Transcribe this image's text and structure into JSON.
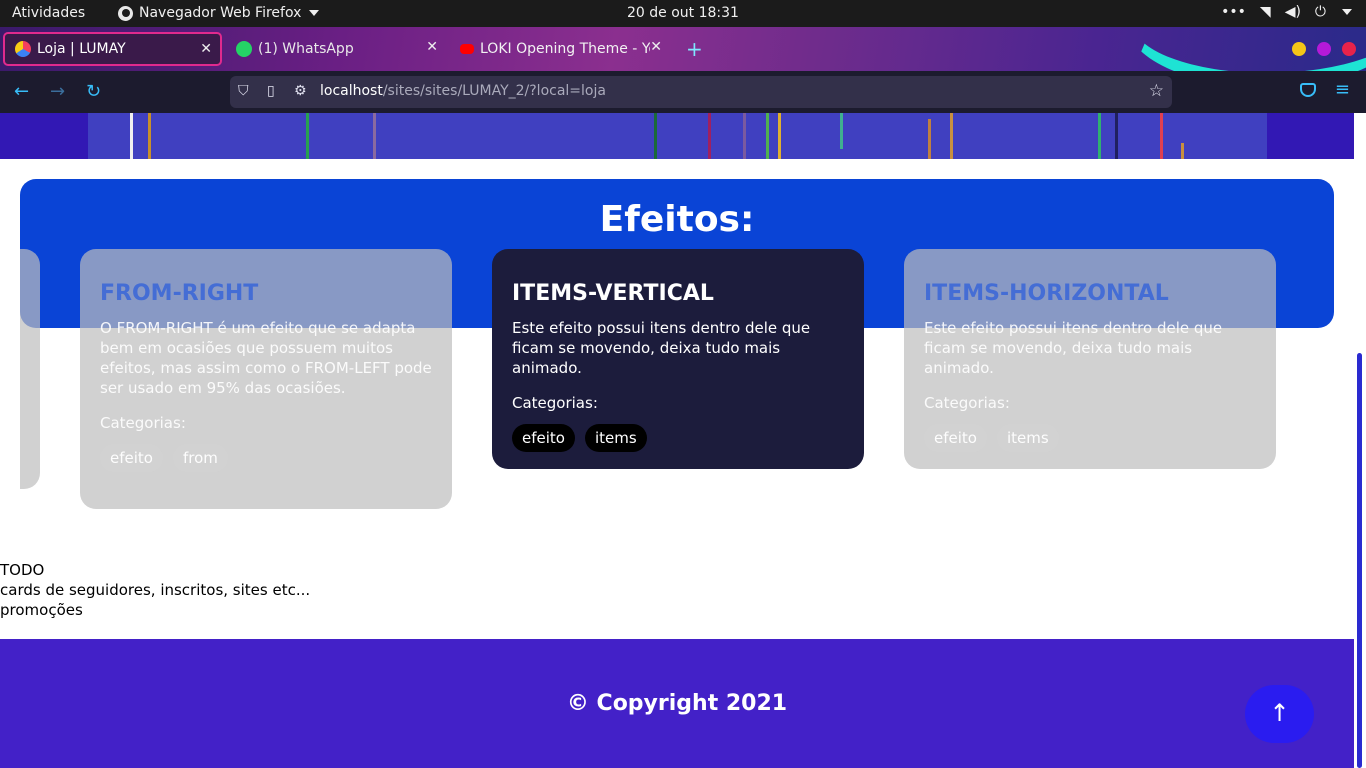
{
  "system_bar": {
    "activities": "Atividades",
    "app_name": "Navegador Web Firefox",
    "clock": "20 de out  18:31"
  },
  "tabs": [
    {
      "title": "Loja | LUMAY",
      "active": true
    },
    {
      "title": "(1) WhatsApp",
      "active": false
    },
    {
      "title": "LOKI Opening Theme - Yo",
      "active": false
    }
  ],
  "address_bar": {
    "host": "localhost",
    "path": "/sites/sites/LUMAY_2/?local=loja"
  },
  "section": {
    "title": "Efeitos:"
  },
  "cards": [
    {
      "title": "FROM-RIGHT",
      "description": "O FROM-RIGHT é um efeito que se adapta bem em ocasiões que possuem muitos efeitos, mas assim como o FROM-LEFT pode ser usado em 95% das ocasiões.",
      "categories_label": "Categorias:",
      "tags": [
        "efeito",
        "from"
      ]
    },
    {
      "title": "ITEMS-VERTICAL",
      "description": "Este efeito possui itens dentro dele que ficam se movendo, deixa tudo mais animado.",
      "categories_label": "Categorias:",
      "tags": [
        "efeito",
        "items"
      ]
    },
    {
      "title": "ITEMS-HORIZONTAL",
      "description": "Este efeito possui itens dentro dele que ficam se movendo, deixa tudo mais animado.",
      "categories_label": "Categorias:",
      "tags": [
        "efeito",
        "items"
      ]
    }
  ],
  "todo": {
    "line1": "TODO",
    "line2": "cards de seguidores, inscritos, sites etc...",
    "line3": "promoções"
  },
  "footer": {
    "copyright": "© Copyright 2021"
  },
  "colors": {
    "header_block": "#0a44d6",
    "dark_card": "#1c1c3c",
    "footer": "#4321c8",
    "to_top_button": "#2a1cf0"
  }
}
